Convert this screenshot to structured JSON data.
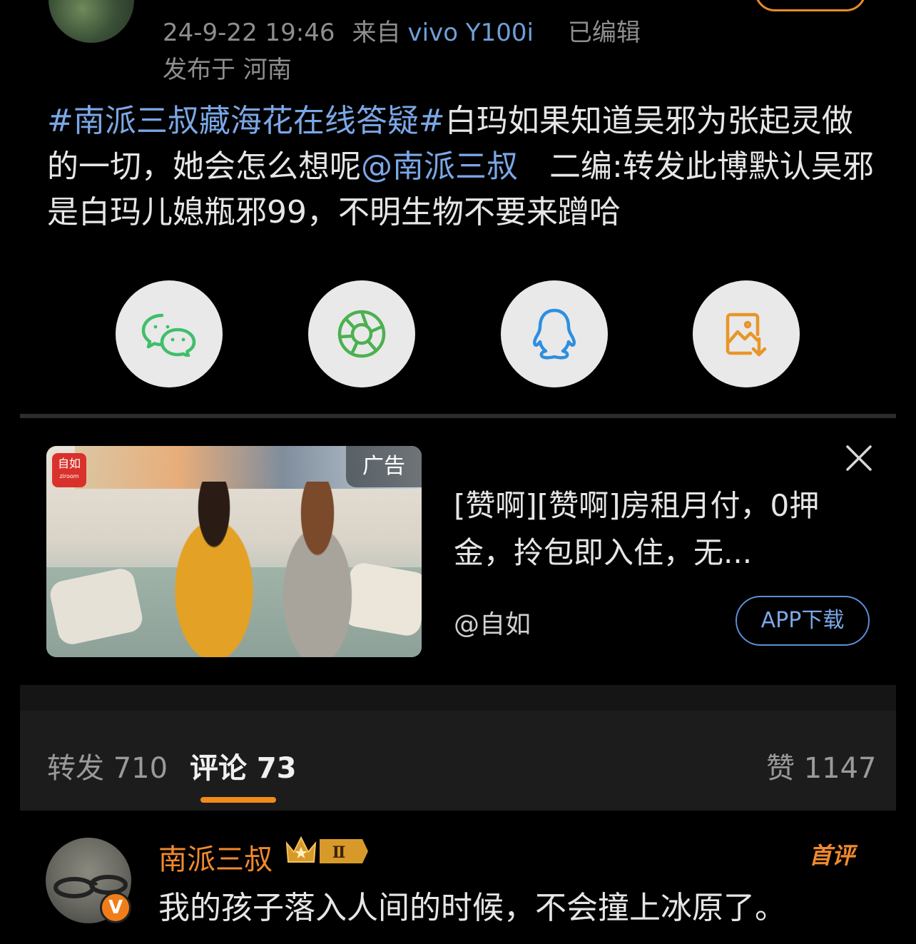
{
  "post": {
    "meta": {
      "datetime": "24-9-22 19:46",
      "from_prefix": "来自",
      "device": "vivo Y100i",
      "edited": "已编辑",
      "location": "发布于 河南"
    },
    "hashtag": "#南派三叔藏海花在线答疑#",
    "body_part1": "白玛如果知道吴邪为张起灵做的一切，她会怎么想呢",
    "mention": "@南派三叔",
    "body_part2": "　二编:转发此博默认吴邪是白玛儿媳瓶邪99，不明生物不要来蹭哈"
  },
  "share": [
    {
      "name": "wechat",
      "icon": "wechat-icon",
      "color": "#3fbf6a"
    },
    {
      "name": "moments",
      "icon": "moments-icon",
      "color": "#4cb050"
    },
    {
      "name": "qq",
      "icon": "qq-icon",
      "color": "#2d8fe0"
    },
    {
      "name": "save-image",
      "icon": "save-image-icon",
      "color": "#e8962a"
    }
  ],
  "ad": {
    "logo_text": "自如",
    "logo_sub": "ziroom",
    "tag": "广告",
    "text": "[赞啊][赞啊]房租月付，0押金，拎包即入住，无...",
    "handle": "@自如",
    "cta": "APP下载"
  },
  "tabs": [
    {
      "label": "转发 710",
      "active": false
    },
    {
      "label": "评论 73",
      "active": true
    },
    {
      "label": "赞 1147",
      "active": false
    }
  ],
  "comment": {
    "author": "南派三叔",
    "level": "Ⅱ",
    "verified_badge": "V",
    "first_tag": "首评",
    "text": "我的孩子落入人间的时候，不会撞上冰原了。"
  },
  "colors": {
    "accent_orange": "#f28a1b",
    "link_blue": "#7ba7e6",
    "background": "#000000"
  }
}
